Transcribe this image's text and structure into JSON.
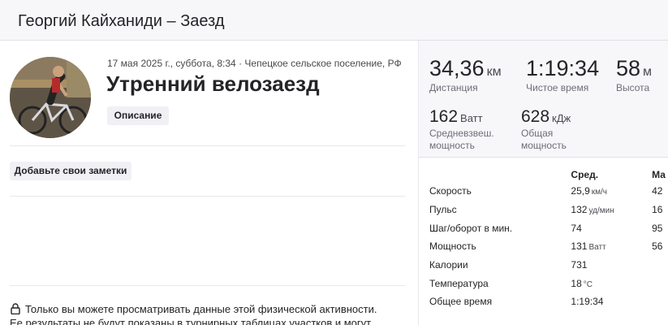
{
  "header": {
    "title": "Георгий Кайханиди – Заезд"
  },
  "activity": {
    "meta": "17 мая 2025 г., суббота, 8:34 · Чепецкое сельское поселение, РФ",
    "title": "Утренний велозаезд",
    "description_button": "Описание",
    "notes_button": "Добавьте свои заметки",
    "privacy_line1": "Только вы можете просматривать данные этой физической активности.",
    "privacy_line2": "Ее результаты не будут показаны в турнирных таблицах участков и могут"
  },
  "summary": {
    "distance": {
      "value": "34,36",
      "unit": "км",
      "label": "Дистанция"
    },
    "moving_time": {
      "value": "1:19:34",
      "label": "Чистое время"
    },
    "elevation": {
      "value": "58",
      "unit": "м",
      "label": "Высота"
    },
    "weighted_power": {
      "value": "162",
      "unit": "Ватт",
      "label_line1": "Средневзвеш.",
      "label_line2": "мощность"
    },
    "total_work": {
      "value": "628",
      "unit": "кДж",
      "label_line1": "Общая",
      "label_line2": "мощность"
    }
  },
  "details": {
    "col_avg": "Сред.",
    "col_max": "Ма",
    "rows": [
      {
        "name": "Скорость",
        "avg": "25,9",
        "avg_unit": "км/ч",
        "max": "42"
      },
      {
        "name": "Пульс",
        "avg": "132",
        "avg_unit": "уд/мин",
        "max": "16"
      },
      {
        "name": "Шаг/оборот в мин.",
        "avg": "74",
        "avg_unit": "",
        "max": "95"
      },
      {
        "name": "Мощность",
        "avg": "131",
        "avg_unit": "Ватт",
        "max": "56"
      },
      {
        "name": "Калории",
        "avg": "731",
        "avg_unit": "",
        "max": ""
      },
      {
        "name": "Температура",
        "avg": "18",
        "avg_unit": "°C",
        "max": ""
      },
      {
        "name": "Общее время",
        "avg": "1:19:34",
        "avg_unit": "",
        "max": ""
      }
    ]
  }
}
